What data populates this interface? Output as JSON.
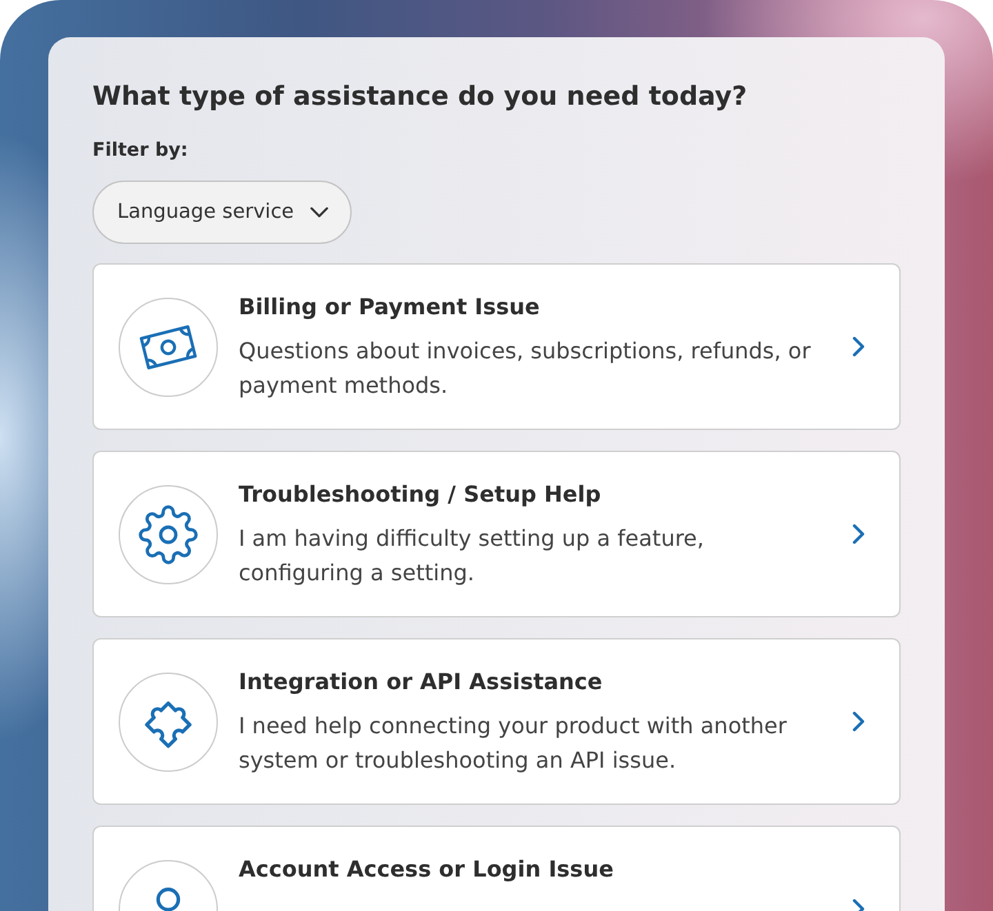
{
  "title": "What type of assistance do you need today?",
  "filter": {
    "label": "Filter by:",
    "value": "Language service"
  },
  "options": [
    {
      "kind": "billing",
      "title": "Billing or Payment Issue",
      "description": "Questions about invoices, subscriptions, refunds, or payment methods."
    },
    {
      "kind": "setup",
      "title": "Troubleshooting / Setup Help",
      "description": "I am having difficulty setting up a feature, configuring a setting."
    },
    {
      "kind": "integration",
      "title": "Integration or API Assistance",
      "description": "I need help connecting your product with another system or troubleshooting an API issue."
    },
    {
      "kind": "account",
      "title": "Account Access or Login Issue"
    }
  ]
}
